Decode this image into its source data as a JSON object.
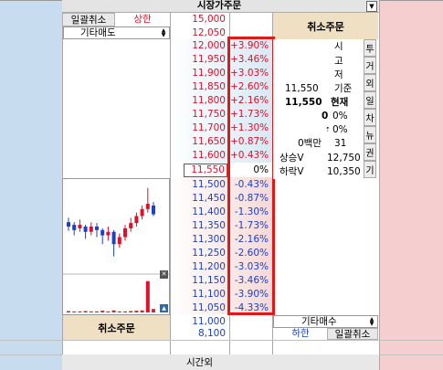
{
  "header": {
    "title": "시장가주문",
    "cancel_all_label": "일괄취소",
    "upper_limit_label": "상한",
    "upper_limit_price": "15,000",
    "other_sell_label": "기타매도",
    "top_price": "12,050",
    "cancel_order_top": "취소주문"
  },
  "ask_rows": [
    {
      "price": "12,000",
      "pct": "+3.90%"
    },
    {
      "price": "11,950",
      "pct": "+3.46%"
    },
    {
      "price": "11,900",
      "pct": "+3.03%"
    },
    {
      "price": "11,850",
      "pct": "+2.60%"
    },
    {
      "price": "11,800",
      "pct": "+2.16%"
    },
    {
      "price": "11,750",
      "pct": "+1.73%"
    },
    {
      "price": "11,700",
      "pct": "+1.30%"
    },
    {
      "price": "11,650",
      "pct": "+0.87%"
    },
    {
      "price": "11,600",
      "pct": "+0.43%"
    }
  ],
  "current_row": {
    "price": "11,550",
    "pct": "0%"
  },
  "bid_rows": [
    {
      "price": "11,500",
      "pct": "-0.43%"
    },
    {
      "price": "11,450",
      "pct": "-0.87%"
    },
    {
      "price": "11,400",
      "pct": "-1.30%"
    },
    {
      "price": "11,350",
      "pct": "-1.73%"
    },
    {
      "price": "11,300",
      "pct": "-2.16%"
    },
    {
      "price": "11,250",
      "pct": "-2.60%"
    },
    {
      "price": "11,200",
      "pct": "-3.03%"
    },
    {
      "price": "11,150",
      "pct": "-3.46%"
    },
    {
      "price": "11,100",
      "pct": "-3.90%"
    },
    {
      "price": "11,050",
      "pct": "-4.33%"
    }
  ],
  "info": {
    "open_label": "시",
    "high_label": "고",
    "low_label": "저",
    "base_value": "11,550",
    "base_label": "기준",
    "current_value": "11,550",
    "current_label": "현재",
    "change_value": "0",
    "change_pct": "0%",
    "change2_pct": "0%",
    "volume_value": "0백만",
    "volume_count": "31",
    "upper_v_label": "상승V",
    "upper_v_value": "12,750",
    "lower_v_label": "하락V",
    "lower_v_value": "10,350"
  },
  "side_tabs": [
    "투",
    "거",
    "외",
    "일",
    "차",
    "뉴",
    "권",
    "기"
  ],
  "footer": {
    "cancel_order_bottom": "취소주문",
    "bottom_price_1": "11,000",
    "bottom_price_2": "8,100",
    "other_buy_label": "기타매수",
    "lower_limit_label": "하한",
    "cancel_all_bottom": "일괄취소",
    "after_hours_label": "시간외"
  },
  "colors": {
    "rise": "#e0102a",
    "fall": "#1c40c8",
    "highlight_box": "#e01818"
  },
  "chart_data": {
    "type": "candlestick",
    "candles": [
      {
        "o": 0.55,
        "c": 0.5,
        "h": 0.6,
        "l": 0.45
      },
      {
        "o": 0.52,
        "c": 0.46,
        "h": 0.55,
        "l": 0.4
      },
      {
        "o": 0.48,
        "c": 0.52,
        "h": 0.58,
        "l": 0.44
      },
      {
        "o": 0.5,
        "c": 0.44,
        "h": 0.52,
        "l": 0.36
      },
      {
        "o": 0.44,
        "c": 0.5,
        "h": 0.55,
        "l": 0.4
      },
      {
        "o": 0.5,
        "c": 0.46,
        "h": 0.54,
        "l": 0.38
      },
      {
        "o": 0.46,
        "c": 0.4,
        "h": 0.48,
        "l": 0.3
      },
      {
        "o": 0.4,
        "c": 0.44,
        "h": 0.5,
        "l": 0.34
      },
      {
        "o": 0.44,
        "c": 0.3,
        "h": 0.46,
        "l": 0.16
      },
      {
        "o": 0.3,
        "c": 0.38,
        "h": 0.42,
        "l": 0.26
      },
      {
        "o": 0.38,
        "c": 0.48,
        "h": 0.52,
        "l": 0.34
      },
      {
        "o": 0.48,
        "c": 0.54,
        "h": 0.6,
        "l": 0.44
      },
      {
        "o": 0.54,
        "c": 0.62,
        "h": 0.66,
        "l": 0.5
      },
      {
        "o": 0.62,
        "c": 0.7,
        "h": 0.74,
        "l": 0.58
      },
      {
        "o": 0.7,
        "c": 0.76,
        "h": 0.94,
        "l": 0.66
      },
      {
        "o": 0.74,
        "c": 0.64,
        "h": 0.78,
        "l": 0.62
      }
    ],
    "volume": [
      0.04,
      0.03,
      0.03,
      0.04,
      0.03,
      0.03,
      0.05,
      0.03,
      0.06,
      0.03,
      0.03,
      0.04,
      0.05,
      0.06,
      0.9,
      0.1
    ]
  }
}
